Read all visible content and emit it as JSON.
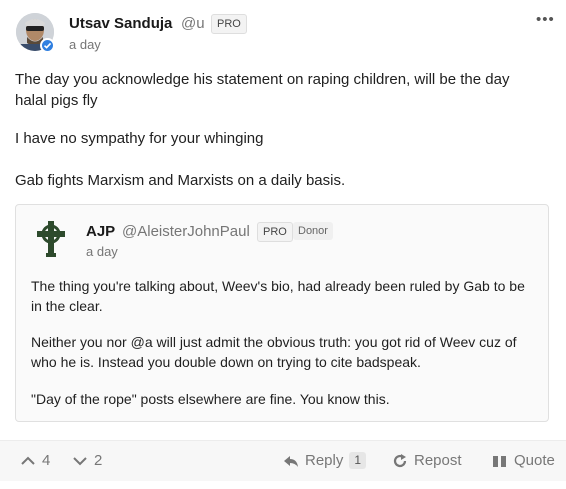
{
  "post": {
    "author": {
      "name": "Utsav Sanduja",
      "handle": "@u",
      "badge": "PRO",
      "verified": true
    },
    "time": "a day",
    "paragraphs": [
      "The day you acknowledge his statement on raping children, will be the day halal pigs fly",
      "I have no sympathy for your whinging",
      "Gab fights Marxism and Marxists on a daily basis."
    ],
    "quoted": {
      "author": {
        "name": "AJP",
        "handle": "@AleisterJohnPaul",
        "badge": "PRO",
        "badge2": "Donor"
      },
      "time": "a day",
      "paragraphs": [
        "The thing you're talking about, Weev's bio, had already been ruled by Gab to be in the clear.",
        "Neither you nor @a will just admit the obvious truth: you got rid of Weev cuz of who he is. Instead you double down on trying to cite badspeak.",
        "\"Day of the rope\" posts elsewhere are fine. You know this."
      ]
    },
    "actions": {
      "upvotes": "4",
      "downvotes": "2",
      "reply_label": "Reply",
      "reply_count": "1",
      "repost_label": "Repost",
      "quote_label": "Quote"
    }
  },
  "colors": {
    "accent_blue": "#2f7fe0",
    "muted_text": "#767676",
    "action_bar_bg": "#f7f7f7",
    "quote_bg": "#fafafa",
    "celtic_cross": "#2d4a2c"
  },
  "icons": [
    "more-icon",
    "verified-icon",
    "celtic-cross-icon",
    "upvote-icon",
    "downvote-icon",
    "reply-icon",
    "repost-icon",
    "quote-icon"
  ]
}
